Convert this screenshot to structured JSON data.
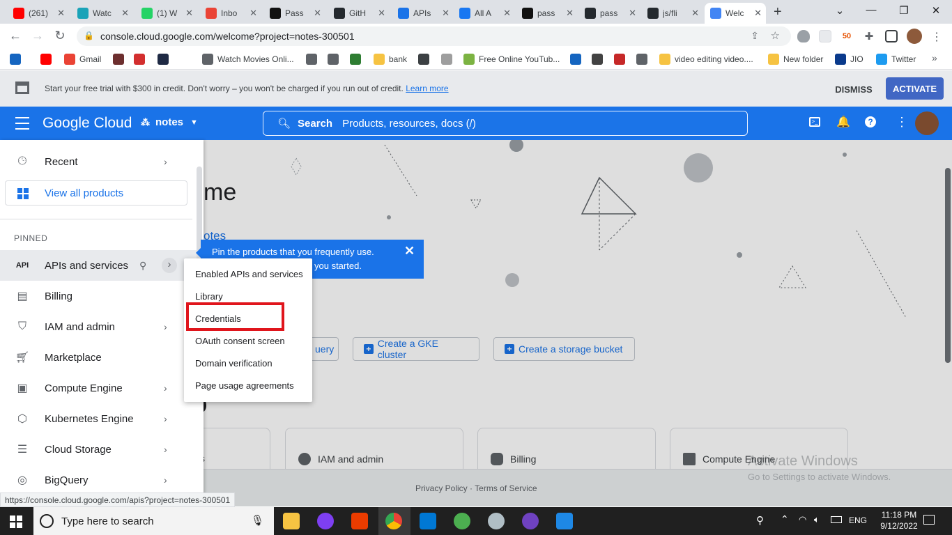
{
  "browser": {
    "tabs": [
      {
        "title": "(261)",
        "icon": "youtube-icon",
        "color": "#ff0000"
      },
      {
        "title": "Watc",
        "icon": "play-icon",
        "color": "#1aa3b8"
      },
      {
        "title": "(1) W",
        "icon": "whatsapp-icon",
        "color": "#25d366"
      },
      {
        "title": "Inbo",
        "icon": "gmail-icon",
        "color": "#ea4335"
      },
      {
        "title": "Pass",
        "icon": "passport-icon",
        "color": "#111111"
      },
      {
        "title": "GitH",
        "icon": "github-icon",
        "color": "#24292e"
      },
      {
        "title": "APIs",
        "icon": "api-icon",
        "color": "#1a73e8"
      },
      {
        "title": "All A",
        "icon": "facebook-icon",
        "color": "#1877f2"
      },
      {
        "title": "pass",
        "icon": "passport-icon",
        "color": "#111111"
      },
      {
        "title": "pass",
        "icon": "github-icon",
        "color": "#24292e"
      },
      {
        "title": "js/fli",
        "icon": "github-icon",
        "color": "#24292e"
      },
      {
        "title": "Welc",
        "icon": "google-cloud-icon",
        "color": "#4285f4",
        "active": true
      }
    ],
    "new_tab": "+",
    "url": "console.cloud.google.com/welcome?project=notes-300501",
    "status_url": "https://console.cloud.google.com/apis?project=notes-300501",
    "bookmarks": [
      {
        "label": "",
        "icon": "d-icon",
        "color": "#1565c0"
      },
      {
        "label": "",
        "icon": "youtube-icon",
        "color": "#ff0000"
      },
      {
        "label": "Gmail",
        "icon": "gmail-icon",
        "color": "#ea4335"
      },
      {
        "label": "",
        "icon": "star-icon",
        "color": "#6d2f2f"
      },
      {
        "label": "",
        "icon": "target-icon",
        "color": "#d32f2f"
      },
      {
        "label": "",
        "icon": "app-icon",
        "color": "#1f2a44"
      },
      {
        "label": "Watch Movies Onli...",
        "icon": "globe-icon",
        "color": "#5f6368"
      },
      {
        "label": "",
        "icon": "globe-icon",
        "color": "#5f6368"
      },
      {
        "label": "",
        "icon": "globe-icon",
        "color": "#5f6368"
      },
      {
        "label": "",
        "icon": "check-icon",
        "color": "#2e7d32"
      },
      {
        "label": "bank",
        "icon": "folder-icon",
        "color": "#f6c342"
      },
      {
        "label": "",
        "icon": "briefcase-icon",
        "color": "#3c4043"
      },
      {
        "label": "",
        "icon": "f4m-icon",
        "color": "#9e9e9e"
      },
      {
        "label": "Free Online YouTub...",
        "icon": "download-icon",
        "color": "#7cb342"
      },
      {
        "label": "",
        "icon": "s-icon",
        "color": "#1565c0"
      },
      {
        "label": "",
        "icon": "m-icon",
        "color": "#424242"
      },
      {
        "label": "",
        "icon": "circle-icon",
        "color": "#c62828"
      },
      {
        "label": "",
        "icon": "globe-icon",
        "color": "#5f6368"
      },
      {
        "label": "video editing video....",
        "icon": "folder-icon",
        "color": "#f6c342"
      },
      {
        "label": "New folder",
        "icon": "folder-icon",
        "color": "#f6c342"
      },
      {
        "label": "JIO",
        "icon": "jio-icon",
        "color": "#0a3a8c"
      },
      {
        "label": "Twitter",
        "icon": "twitter-icon",
        "color": "#1d9bf0"
      }
    ],
    "more_bookmarks": "»"
  },
  "trial_banner": {
    "message": "Start your free trial with $300 in credit. Don't worry – you won't be charged if you run out of credit.",
    "learn_more": "Learn more",
    "dismiss": "DISMISS",
    "activate": "ACTIVATE"
  },
  "header": {
    "logo": "Google Cloud",
    "project": "notes",
    "search_label": "Search",
    "search_placeholder": "Products, resources, docs (/)"
  },
  "sidebar": {
    "recent": "Recent",
    "view_all": "View all products",
    "pinned_label": "PINNED",
    "items": [
      {
        "label": "APIs and services",
        "icon": "api-icon",
        "chevron": true
      },
      {
        "label": "Billing",
        "icon": "billing-icon",
        "chevron": false
      },
      {
        "label": "IAM and admin",
        "icon": "shield-icon",
        "chevron": true
      },
      {
        "label": "Marketplace",
        "icon": "cart-icon",
        "chevron": false
      },
      {
        "label": "Compute Engine",
        "icon": "chip-icon",
        "chevron": true
      },
      {
        "label": "Kubernetes Engine",
        "icon": "kubernetes-icon",
        "chevron": true
      },
      {
        "label": "Cloud Storage",
        "icon": "storage-icon",
        "chevron": true
      },
      {
        "label": "BigQuery",
        "icon": "bigquery-icon",
        "chevron": true
      }
    ]
  },
  "submenu": {
    "items": [
      "Enabled APIs and services",
      "Library",
      "Credentials",
      "OAuth consent screen",
      "Domain verification",
      "Page usage agreements"
    ],
    "highlighted": "Credentials"
  },
  "tooltip": {
    "line1": "Pin the products that you frequently use.",
    "line2": "you started."
  },
  "main": {
    "welcome_fragment": "me",
    "project_fragment": "otes",
    "actions": [
      "uery",
      "Create a GKE cluster",
      "Create a storage bucket"
    ],
    "cards": [
      "s",
      "IAM and admin",
      "Billing",
      "Compute Engine"
    ],
    "footer": {
      "privacy": "Privacy Policy",
      "sep": "·",
      "terms": "Terms of Service"
    },
    "watermark": {
      "line1": "Activate Windows",
      "line2": "Go to Settings to activate Windows."
    }
  },
  "taskbar": {
    "search_placeholder": "Type here to search",
    "lang": "ENG",
    "time": "11:18 PM",
    "date": "9/12/2022"
  }
}
